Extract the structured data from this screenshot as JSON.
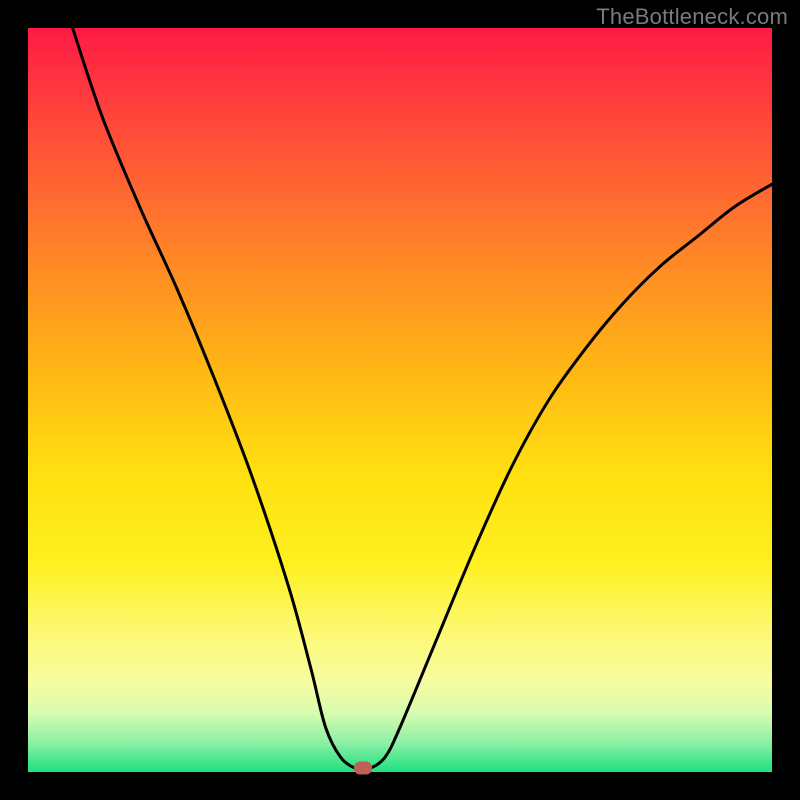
{
  "watermark": "TheBottleneck.com",
  "colors": {
    "frame": "#000000",
    "curve": "#000000",
    "marker": "#c06055",
    "gradient_stops": [
      {
        "pos": 0,
        "hex": "#ff1a45"
      },
      {
        "pos": 6,
        "hex": "#ff3040"
      },
      {
        "pos": 18,
        "hex": "#ff5a35"
      },
      {
        "pos": 32,
        "hex": "#ff8a25"
      },
      {
        "pos": 46,
        "hex": "#ffb715"
      },
      {
        "pos": 60,
        "hex": "#ffe010"
      },
      {
        "pos": 72,
        "hex": "#fff020"
      },
      {
        "pos": 82,
        "hex": "#fdf97a"
      },
      {
        "pos": 88,
        "hex": "#f6fca0"
      },
      {
        "pos": 92,
        "hex": "#d8fcb0"
      },
      {
        "pos": 96,
        "hex": "#8ef0a5"
      },
      {
        "pos": 100,
        "hex": "#1ee080"
      }
    ]
  },
  "chart_data": {
    "type": "line",
    "title": "",
    "xlabel": "",
    "ylabel": "",
    "xlim": [
      0,
      100
    ],
    "ylim": [
      0,
      100
    ],
    "note": "Axis units not labeled in source image; values are estimated percentages of plot area (0=bottom-left).",
    "series": [
      {
        "name": "bottleneck-curve",
        "x": [
          6,
          10,
          15,
          20,
          25,
          30,
          35,
          38,
          40,
          42,
          44,
          45,
          46,
          48,
          50,
          55,
          60,
          65,
          70,
          75,
          80,
          85,
          90,
          95,
          100
        ],
        "y": [
          100,
          88,
          76,
          65,
          53,
          40,
          25,
          14,
          6,
          2,
          0.5,
          0.5,
          0.5,
          2,
          6,
          18,
          30,
          41,
          50,
          57,
          63,
          68,
          72,
          76,
          79
        ]
      }
    ],
    "marker": {
      "x": 45,
      "y": 0.5
    },
    "grid": false,
    "legend": false
  }
}
